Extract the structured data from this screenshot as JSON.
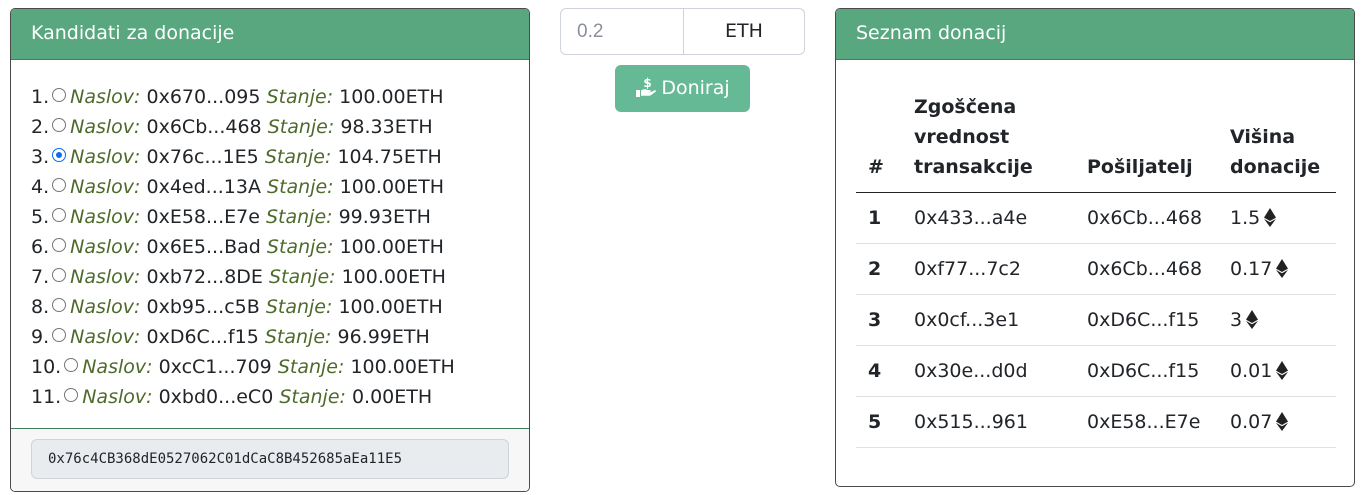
{
  "candidates_card": {
    "title": "Kandidati za donacije",
    "address_label": "Naslov:",
    "balance_label": "Stanje:",
    "items": [
      {
        "num": "1.",
        "address": "0x670...095",
        "balance": "100.00ETH",
        "selected": false
      },
      {
        "num": "2.",
        "address": "0x6Cb...468",
        "balance": "98.33ETH",
        "selected": false
      },
      {
        "num": "3.",
        "address": "0x76c...1E5",
        "balance": "104.75ETH",
        "selected": true
      },
      {
        "num": "4.",
        "address": "0x4ed...13A",
        "balance": "100.00ETH",
        "selected": false
      },
      {
        "num": "5.",
        "address": "0xE58...E7e",
        "balance": "99.93ETH",
        "selected": false
      },
      {
        "num": "6.",
        "address": "0x6E5...Bad",
        "balance": "100.00ETH",
        "selected": false
      },
      {
        "num": "7.",
        "address": "0xb72...8DE",
        "balance": "100.00ETH",
        "selected": false
      },
      {
        "num": "8.",
        "address": "0xb95...c5B",
        "balance": "100.00ETH",
        "selected": false
      },
      {
        "num": "9.",
        "address": "0xD6C...f15",
        "balance": "96.99ETH",
        "selected": false
      },
      {
        "num": "10.",
        "address": "0xcC1...709",
        "balance": "100.00ETH",
        "selected": false
      },
      {
        "num": "11.",
        "address": "0xbd0...eC0",
        "balance": "0.00ETH",
        "selected": false
      }
    ],
    "selected_address": "0x76c4CB368dE0527062C01dCaC8B452685aEa11E5"
  },
  "donate": {
    "amount_placeholder": "0.2",
    "amount_value": "",
    "unit": "ETH",
    "button_label": "Doniraj",
    "button_icon": "hand-holding-dollar-icon"
  },
  "donations_card": {
    "title": "Seznam donacij",
    "headers": {
      "index": "#",
      "hash": "Zgoščena vrednost transakcije",
      "sender": "Pošiljatelj",
      "amount": "Višina donacije"
    },
    "rows": [
      {
        "index": "1",
        "hash": "0x433...a4e",
        "sender": "0x6Cb...468",
        "amount": "1.5"
      },
      {
        "index": "2",
        "hash": "0xf77...7c2",
        "sender": "0x6Cb...468",
        "amount": "0.17"
      },
      {
        "index": "3",
        "hash": "0x0cf...3e1",
        "sender": "0xD6C...f15",
        "amount": "3"
      },
      {
        "index": "4",
        "hash": "0x30e...d0d",
        "sender": "0xD6C...f15",
        "amount": "0.01"
      },
      {
        "index": "5",
        "hash": "0x515...961",
        "sender": "0xE58...E7e",
        "amount": "0.07"
      }
    ],
    "amount_icon": "ethereum-icon"
  },
  "colors": {
    "header_green": "#58a77f",
    "button_green": "#65b995",
    "label_olive": "#4d6a2b",
    "radio_blue": "#0b6cf1"
  }
}
